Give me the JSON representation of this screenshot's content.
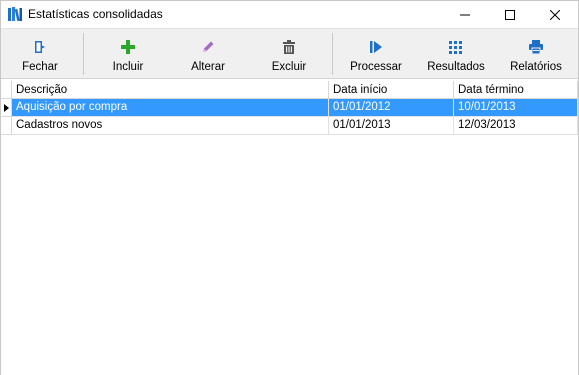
{
  "window": {
    "title": "Estatísticas consolidadas",
    "icon": "books-icon"
  },
  "toolbar": {
    "buttons": [
      {
        "id": "fechar",
        "label": "Fechar",
        "icon": "exit-door-icon",
        "color": "#1e6fc8"
      },
      {
        "id": "incluir",
        "label": "Incluir",
        "icon": "plus-icon",
        "color": "#2aa829"
      },
      {
        "id": "alterar",
        "label": "Alterar",
        "icon": "pencil-icon",
        "color": "#9b59b6"
      },
      {
        "id": "excluir",
        "label": "Excluir",
        "icon": "trash-icon",
        "color": "#555555"
      },
      {
        "id": "processar",
        "label": "Processar",
        "icon": "play-icon",
        "color": "#1e6fc8"
      },
      {
        "id": "resultados",
        "label": "Resultados",
        "icon": "grid-dots-icon",
        "color": "#1e6fc8"
      },
      {
        "id": "relatorios",
        "label": "Relatórios",
        "icon": "printer-icon",
        "color": "#1e6fc8"
      }
    ]
  },
  "grid": {
    "columns": [
      "Descrição",
      "Data início",
      "Data término"
    ],
    "rows": [
      {
        "descricao": "Aquisição por compra",
        "data_inicio": "01/01/2012",
        "data_termino": "10/01/2013",
        "selected": true
      },
      {
        "descricao": "Cadastros novos",
        "data_inicio": "01/01/2013",
        "data_termino": "12/03/2013",
        "selected": false
      }
    ]
  },
  "colors": {
    "selection": "#3399ff",
    "toolbar_bg": "#f0f0f0"
  }
}
